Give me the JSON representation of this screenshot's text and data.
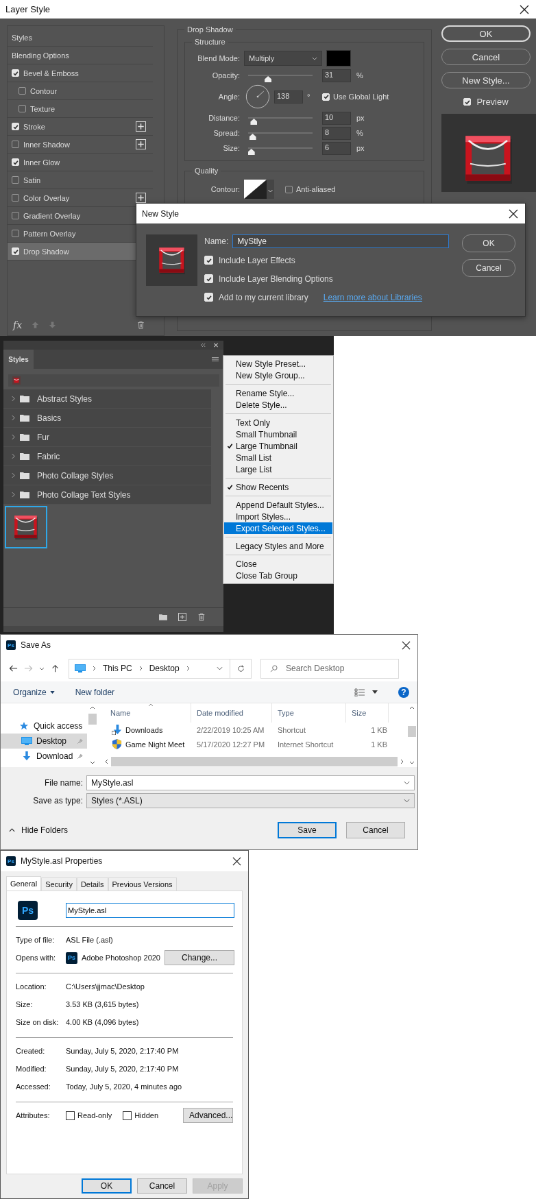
{
  "layer_style": {
    "title": "Layer Style",
    "effects": [
      {
        "kind": "header",
        "label": "Styles",
        "selected": false
      },
      {
        "kind": "header",
        "label": "Blending Options",
        "selected": false
      },
      {
        "kind": "effect",
        "label": "Bevel & Emboss",
        "checked": true,
        "selected": false,
        "children": [
          {
            "kind": "effect",
            "label": "Contour",
            "checked": false,
            "selected": false
          },
          {
            "kind": "effect",
            "label": "Texture",
            "checked": false,
            "selected": false
          }
        ]
      },
      {
        "kind": "effect",
        "label": "Stroke",
        "checked": true,
        "selected": false,
        "addable": true
      },
      {
        "kind": "effect",
        "label": "Inner Shadow",
        "checked": false,
        "selected": false,
        "addable": true
      },
      {
        "kind": "effect",
        "label": "Inner Glow",
        "checked": true,
        "selected": false
      },
      {
        "kind": "effect",
        "label": "Satin",
        "checked": false,
        "selected": false
      },
      {
        "kind": "effect",
        "label": "Color Overlay",
        "checked": false,
        "selected": false,
        "addable": true
      },
      {
        "kind": "effect",
        "label": "Gradient Overlay",
        "checked": false,
        "selected": false
      },
      {
        "kind": "effect",
        "label": "Pattern Overlay",
        "checked": false,
        "selected": false
      },
      {
        "kind": "effect",
        "label": "Drop Shadow",
        "checked": true,
        "selected": true
      }
    ],
    "fx_label": "fx",
    "drop_shadow": {
      "title": "Drop Shadow",
      "structure_title": "Structure",
      "blend_label": "Blend Mode:",
      "blend_value": "Multiply",
      "rows": [
        {
          "kind": "slider",
          "label": "Opacity:",
          "value": "31",
          "unit": "%",
          "level": 0.31
        },
        {
          "kind": "angle",
          "label": "Angle:",
          "value": "138",
          "unit": "°",
          "option": "Use Global Light",
          "checked": true
        },
        {
          "kind": "slider",
          "label": "Distance:",
          "value": "10",
          "unit": "px",
          "level": 0.09
        },
        {
          "kind": "slider",
          "label": "Spread:",
          "value": "8",
          "unit": "%",
          "level": 0.07
        },
        {
          "kind": "slider",
          "label": "Size:",
          "value": "6",
          "unit": "px",
          "level": 0.05
        }
      ],
      "quality_title": "Quality",
      "contour_label": "Contour:",
      "anti_aliased": {
        "label": "Anti-aliased",
        "checked": false
      }
    },
    "buttons": [
      "OK",
      "Cancel",
      "New Style..."
    ],
    "preview": {
      "label": "Preview",
      "checked": true
    }
  },
  "new_style": {
    "title": "New Style",
    "name_label": "Name:",
    "name_value": "MyStlye",
    "options": [
      {
        "label": "Include Layer Effects",
        "checked": true
      },
      {
        "label": "Include Layer Blending Options",
        "checked": true
      },
      {
        "label": "Add to my current library",
        "checked": true
      }
    ],
    "link": "Learn more about Libraries",
    "buttons": [
      "OK",
      "Cancel"
    ]
  },
  "styles_panel": {
    "tab": "Styles",
    "groups": [
      "Abstract Styles",
      "Basics",
      "Fur",
      "Fabric",
      "Photo Collage Styles",
      "Photo Collage Text Styles"
    ],
    "menu": [
      [
        {
          "label": "New Style Preset...",
          "checked": false,
          "selected": false
        },
        {
          "label": "New Style Group...",
          "checked": false,
          "selected": false
        }
      ],
      [
        {
          "label": "Rename Style...",
          "checked": false,
          "selected": false
        },
        {
          "label": "Delete Style...",
          "checked": false,
          "selected": false
        }
      ],
      [
        {
          "label": "Text Only",
          "checked": false,
          "selected": false
        },
        {
          "label": "Small Thumbnail",
          "checked": false,
          "selected": false
        },
        {
          "label": "Large Thumbnail",
          "checked": true,
          "selected": false
        },
        {
          "label": "Small List",
          "checked": false,
          "selected": false
        },
        {
          "label": "Large List",
          "checked": false,
          "selected": false
        }
      ],
      [
        {
          "label": "Show Recents",
          "checked": true,
          "selected": false
        }
      ],
      [
        {
          "label": "Append Default Styles...",
          "checked": false,
          "selected": false
        },
        {
          "label": "Import Styles...",
          "checked": false,
          "selected": false
        },
        {
          "label": "Export Selected Styles...",
          "checked": false,
          "selected": true
        }
      ],
      [
        {
          "label": "Legacy Styles and More",
          "checked": false,
          "selected": false
        }
      ],
      [
        {
          "label": "Close",
          "checked": false,
          "selected": false
        },
        {
          "label": "Close Tab Group",
          "checked": false,
          "selected": false
        }
      ]
    ]
  },
  "save_as": {
    "app_icon": "Ps",
    "title": "Save As",
    "path": [
      "This PC",
      "Desktop"
    ],
    "search_placeholder": "Search Desktop",
    "toolbar": [
      "Organize",
      "New folder"
    ],
    "help": "?",
    "nav": [
      {
        "kind": "star",
        "label": "Quick access",
        "selected": false
      },
      {
        "kind": "desktop",
        "label": "Desktop",
        "selected": true,
        "pinned": true
      },
      {
        "kind": "download",
        "label": "Download",
        "selected": false,
        "pinned": true
      }
    ],
    "columns": [
      "Name",
      "Date modified",
      "Type",
      "Size"
    ],
    "rows": [
      {
        "kind": "download",
        "cells": [
          "Downloads",
          "2/22/2019 10:25 AM",
          "Shortcut",
          "1 KB"
        ]
      },
      {
        "kind": "shield",
        "cells": [
          "Game Night Meet",
          "5/17/2020 12:27 PM",
          "Internet Shortcut",
          "1 KB"
        ]
      }
    ],
    "file_name_label": "File name:",
    "file_name": "MyStyle.asl",
    "type_label": "Save as type:",
    "type_value": "Styles (*.ASL)",
    "hide_folders": "Hide Folders",
    "buttons": [
      "Save",
      "Cancel"
    ]
  },
  "properties": {
    "app_icon": "Ps",
    "title": "MyStyle.asl Properties",
    "tabs": [
      {
        "label": "General",
        "selected": true
      },
      {
        "label": "Security",
        "selected": false
      },
      {
        "label": "Details",
        "selected": false
      },
      {
        "label": "Previous Versions",
        "selected": false
      }
    ],
    "big_icon": "Ps",
    "name_value": "MyStyle.asl",
    "type_label": "Type of file:",
    "type_value": "ASL File (.asl)",
    "opens_label": "Opens with:",
    "opens_icon": "Ps",
    "opens_value": "Adobe Photoshop 2020",
    "change_button": "Change...",
    "info": [
      {
        "label": "Location:",
        "value": "C:\\Users\\jjmac\\Desktop"
      },
      {
        "label": "Size:",
        "value": "3.53 KB (3,615 bytes)"
      },
      {
        "label": "Size on disk:",
        "value": "4.00 KB (4,096 bytes)"
      }
    ],
    "dates": [
      {
        "label": "Created:",
        "value": "Sunday, July 5, 2020, 2:17:40 PM"
      },
      {
        "label": "Modified:",
        "value": "Sunday, July 5, 2020, 2:17:40 PM"
      },
      {
        "label": "Accessed:",
        "value": "Today, July 5, 2020, 4 minutes ago"
      }
    ],
    "attributes_label": "Attributes:",
    "attributes": [
      {
        "label": "Read-only",
        "checked": false
      },
      {
        "label": "Hidden",
        "checked": false
      }
    ],
    "advanced_button": "Advanced...",
    "buttons": [
      {
        "label": "OK",
        "disabled": false
      },
      {
        "label": "Cancel",
        "disabled": false
      },
      {
        "label": "Apply",
        "disabled": true
      }
    ]
  }
}
